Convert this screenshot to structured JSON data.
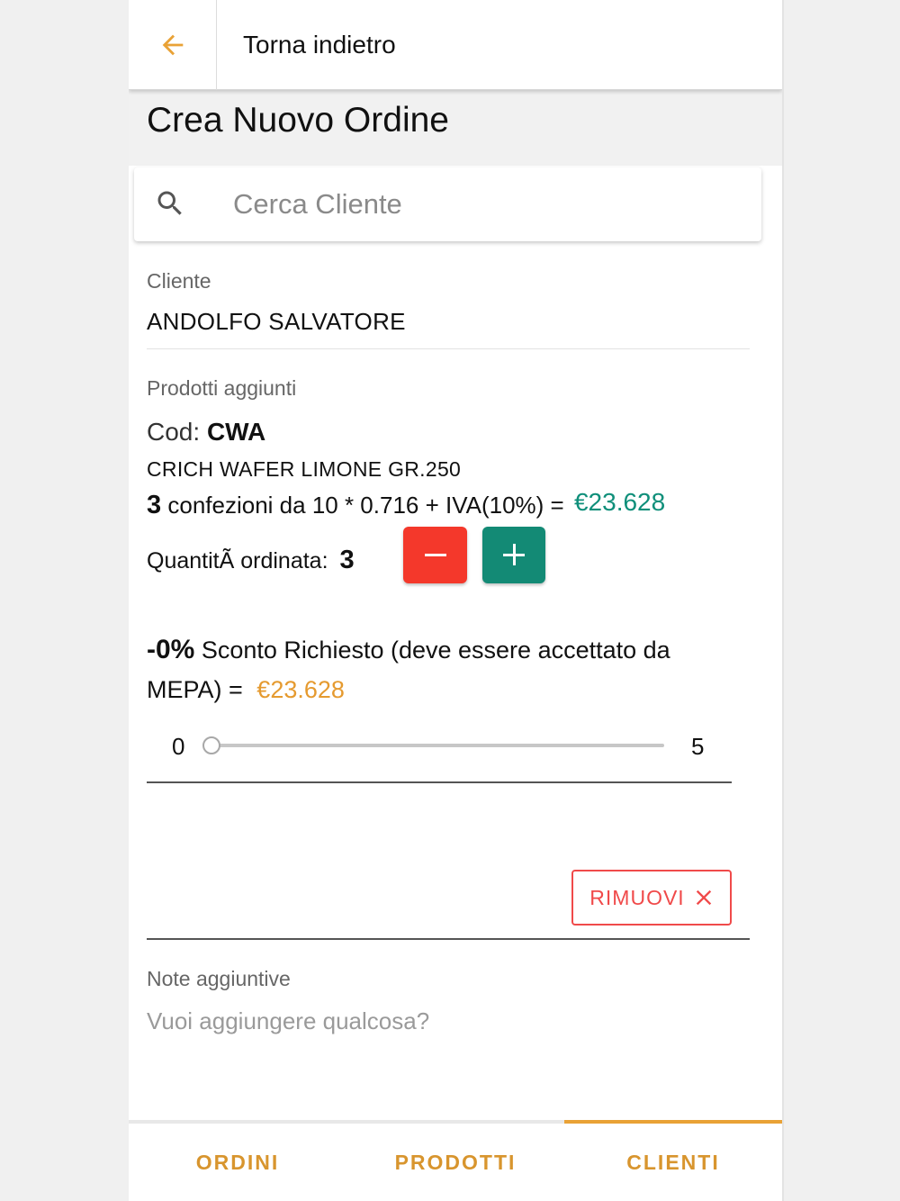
{
  "header": {
    "back_label": "Torna indietro"
  },
  "page": {
    "title": "Crea Nuovo Ordine"
  },
  "search": {
    "placeholder": "Cerca Cliente"
  },
  "client": {
    "label": "Cliente",
    "name": "ANDOLFO SALVATORE"
  },
  "products": {
    "section_label": "Prodotti aggiunti",
    "items": [
      {
        "code_prefix": "Cod:",
        "code": "CWA",
        "name": "CRICH WAFER LIMONE GR.250",
        "packs": "3",
        "calc_text": "confezioni da 10 * 0.716 + IVA(10%) =",
        "total": "€23.628",
        "qty_label": "QuantitÃ  ordinata:",
        "qty": "3",
        "discount_pct": "-0%",
        "discount_text": "Sconto Richiesto (deve essere accettato da MEPA) =",
        "discounted_total": "€23.628",
        "slider": {
          "min_label": "0",
          "max_label": "5",
          "value": 0
        },
        "remove_label": "RIMUOVI"
      }
    ]
  },
  "notes": {
    "label": "Note aggiuntive",
    "placeholder": "Vuoi aggiungere qualcosa?"
  },
  "nav": {
    "items": [
      {
        "label": "ORDINI"
      },
      {
        "label": "PRODOTTI"
      },
      {
        "label": "CLIENTI"
      }
    ],
    "active": "CLIENTI"
  },
  "colors": {
    "accent": "#e9a236",
    "price_green": "#0f8f7a",
    "minus_button": "#f4382b",
    "plus_button": "#138a75",
    "remove": "#f04a4a"
  }
}
